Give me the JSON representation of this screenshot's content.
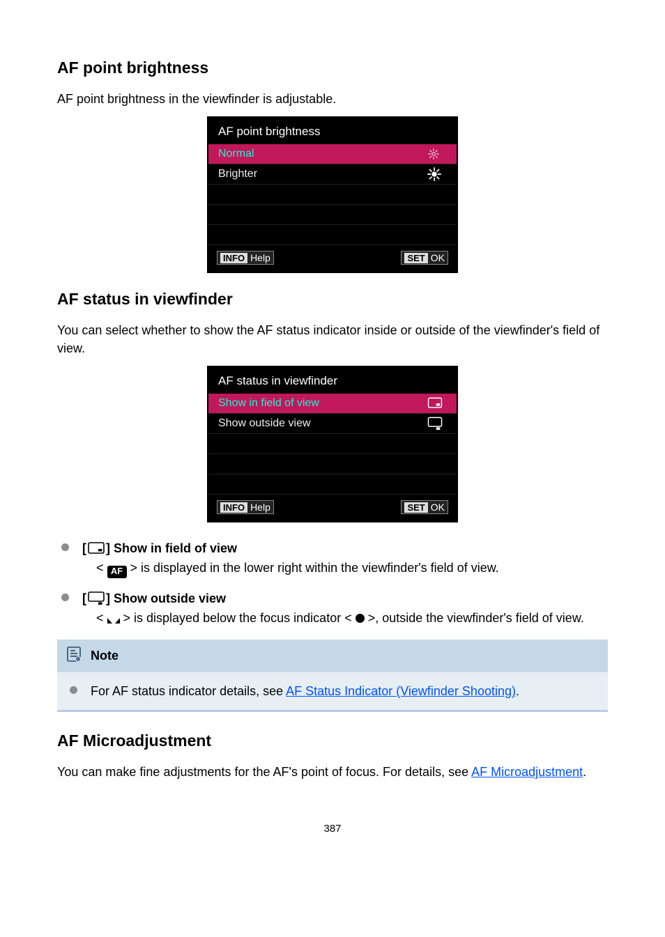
{
  "sections": {
    "afPointBrightness": {
      "heading": "AF point brightness",
      "intro": "AF point brightness in the viewfinder is adjustable.",
      "menu": {
        "title": "AF point brightness",
        "optNormal": "Normal",
        "optBrighter": "Brighter",
        "footerInfo": "INFO",
        "footerHelp": "Help",
        "footerSet": "SET",
        "footerOk": "OK"
      }
    },
    "afStatus": {
      "heading": "AF status in viewfinder",
      "intro": "You can select whether to show the AF status indicator inside or outside of the viewfinder's field of view.",
      "menu": {
        "title": "AF status in viewfinder",
        "optIn": "Show in field of view",
        "optOut": "Show outside view",
        "footerInfo": "INFO",
        "footerHelp": "Help",
        "footerSet": "SET",
        "footerOk": "OK"
      },
      "items": {
        "inHeadPrefix": "[",
        "inHeadSuffix": "] Show in field of view",
        "inBodyPre": "< ",
        "inBodyAfBadge": "AF",
        "inBodyPost": " > is displayed in the lower right within the viewfinder's field of view.",
        "outHeadPrefix": "[",
        "outHeadSuffix": "] Show outside view",
        "outBodyPre": "< ",
        "outBodyMid": " > is displayed below the focus indicator < ",
        "outBodyPost": " >, outside the viewfinder's field of view."
      },
      "note": {
        "label": "Note",
        "bodyPre": "For AF status indicator details, see ",
        "link": "AF Status Indicator (Viewfinder Shooting)",
        "bodyPost": "."
      }
    },
    "afMicro": {
      "heading": "AF Microadjustment",
      "bodyPre": "You can make fine adjustments for the AF's point of focus. For details, see ",
      "link": "AF Microadjustment",
      "bodyPost": "."
    }
  },
  "pageNumber": "387"
}
